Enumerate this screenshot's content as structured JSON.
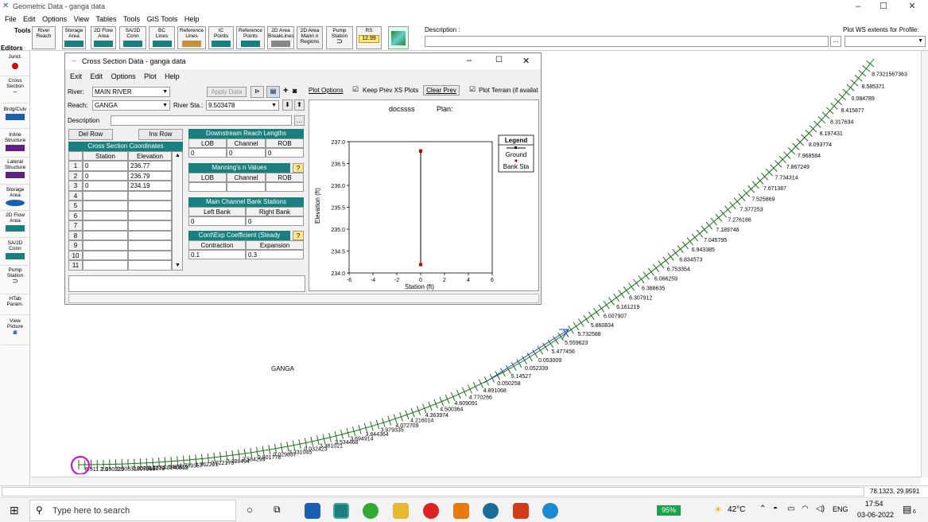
{
  "window": {
    "title": "Geometric Data - ganga data"
  },
  "menu": [
    "File",
    "Edit",
    "Options",
    "View",
    "Tables",
    "Tools",
    "GIS Tools",
    "Help"
  ],
  "toolbar": {
    "tools_label": "Tools",
    "editors_label": "Editors",
    "buttons": [
      "River\nReach",
      "Storage\nArea",
      "2D Flow\nArea",
      "SA/2D\nConn",
      "BC\nLines",
      "Reference\nLines",
      "IC\nPoints",
      "Reference\nPoints",
      "2D Area\nBreakLines",
      "2D Area\nMann n\nRegions",
      "Pump\nStation",
      "RS"
    ],
    "rs_value": "12.99",
    "description_label": "Description :",
    "plot_ws_label": "Plot WS extents for Profile:"
  },
  "leftbar": [
    "Junct.",
    "Cross\nSection",
    "Brdg/Culv",
    "Inline\nStructure",
    "Lateral\nStructure",
    "Storage\nArea",
    "2D Flow\nArea",
    "SA/2D\nConn",
    "Pump\nStation",
    "HTab\nParam.",
    "View\nPicture"
  ],
  "xs_dialog": {
    "title": "Cross Section Data - ganga data",
    "menu": [
      "Exit",
      "Edit",
      "Options",
      "Plot",
      "Help"
    ],
    "river_label": "River:",
    "river_value": "MAIN RIVER",
    "apply_label": "Apply Data",
    "reach_label": "Reach:",
    "reach_value": "GANGA",
    "river_sta_label": "River Sta.:",
    "river_sta_value": "9.503478",
    "description_label": "Description",
    "del_row": "Del Row",
    "ins_row": "Ins Row",
    "coords_title": "Cross Section Coordinates",
    "coords_headers": [
      "Station",
      "Elevation"
    ],
    "coords_rows": [
      {
        "n": "1",
        "station": "0",
        "elev": "236.77"
      },
      {
        "n": "2",
        "station": "0",
        "elev": "236.79"
      },
      {
        "n": "3",
        "station": "0",
        "elev": "234.19"
      },
      {
        "n": "4",
        "station": "",
        "elev": ""
      },
      {
        "n": "5",
        "station": "",
        "elev": ""
      },
      {
        "n": "6",
        "station": "",
        "elev": ""
      },
      {
        "n": "7",
        "station": "",
        "elev": ""
      },
      {
        "n": "8",
        "station": "",
        "elev": ""
      },
      {
        "n": "9",
        "station": "",
        "elev": ""
      },
      {
        "n": "10",
        "station": "",
        "elev": ""
      },
      {
        "n": "11",
        "station": "",
        "elev": ""
      }
    ],
    "ds_title": "Downstream Reach Lengths",
    "ds_headers": [
      "LOB",
      "Channel",
      "ROB"
    ],
    "ds_values": [
      "0",
      "0",
      "0"
    ],
    "mann_title": "Manning's n Values",
    "mann_headers": [
      "LOB",
      "Channel",
      "ROB"
    ],
    "bank_title": "Main Channel Bank Stations",
    "bank_headers": [
      "Left Bank",
      "Right Bank"
    ],
    "bank_values": [
      "0",
      "0"
    ],
    "coef_title": "Cont\\Exp Coefficient (Steady",
    "coef_headers": [
      "Contraction",
      "Expansion"
    ],
    "coef_values": [
      "0.1",
      "0.3"
    ],
    "help_q": "?",
    "plot_options": "Plot Options",
    "keep_prev": "Keep Prev XS Plots",
    "clear_prev": "Clear Prev",
    "plot_terrain": "Plot Terrain (if availat"
  },
  "chart_data": {
    "type": "line",
    "title": "docssss",
    "plan_label": "Plan:",
    "xlabel": "Station (ft)",
    "ylabel": "Elevation (ft)",
    "xlim": [
      -6,
      6
    ],
    "ylim": [
      234.0,
      237.0
    ],
    "xticks": [
      -6,
      -4,
      -2,
      0,
      2,
      4,
      6
    ],
    "yticks": [
      234.0,
      234.5,
      235.0,
      235.5,
      236.0,
      236.5,
      237.0
    ],
    "series": [
      {
        "name": "Ground",
        "x": [
          0,
          0,
          0
        ],
        "y": [
          236.77,
          236.79,
          234.19
        ]
      }
    ],
    "bank_points": [
      {
        "x": 0,
        "y": 236.79
      },
      {
        "x": 0,
        "y": 234.19
      }
    ],
    "legend": {
      "title": "Legend",
      "entries": [
        "Ground",
        "Bank Sta"
      ],
      "placement": "top-right"
    },
    "colors": {
      "ground": "#000000",
      "bank": "#cc0000"
    }
  },
  "map": {
    "reach_label": "GANGA",
    "xs_labels": [
      "8.7321567363",
      "8.585371",
      "0.084789",
      "8.415877",
      "8.317634",
      "8.197431",
      "8.093774",
      "7.968584",
      "7.867249",
      "7.734314",
      "7.671387",
      "7.525869",
      "7.377253",
      "7.276186",
      "7.189746",
      "7.045795",
      "6.943385",
      "6.834573",
      "6.753354",
      "6.066259",
      "6.388635",
      "6.307912",
      "6.161219",
      "6.007907",
      "5.860834",
      "5.732588",
      "5.559623",
      "5.477456",
      "0.053009",
      "0.052339",
      "5.14527",
      "0.050258",
      "4.891068",
      "4.770266",
      "4.609091",
      "4.500364",
      "4.363974",
      "4.216014",
      "4.072709",
      "3.979335",
      "3.844364",
      "3.694914",
      "3.534468",
      "3.381021",
      "0.032423",
      "3.231045",
      "0.029837",
      "2.801778",
      "2.584299",
      "2.388494",
      "0.022175",
      "1.962221",
      "1.789357",
      "1.548923",
      "1.2332.0140013",
      "0.008318079",
      "0.00831807966",
      "1.390225",
      "8.511.2.6"
    ],
    "colors": {
      "xs": "#1a6e1a",
      "reach": "#2040d0",
      "select": "#d000d0"
    }
  },
  "status": {
    "coords": "78.1323, 29.9591"
  },
  "taskbar": {
    "search": "Type here to search",
    "battery": "95%",
    "temp": "42°C",
    "lang": "ENG",
    "time": "17:54",
    "date": "03-06-2022",
    "notif": "6"
  }
}
